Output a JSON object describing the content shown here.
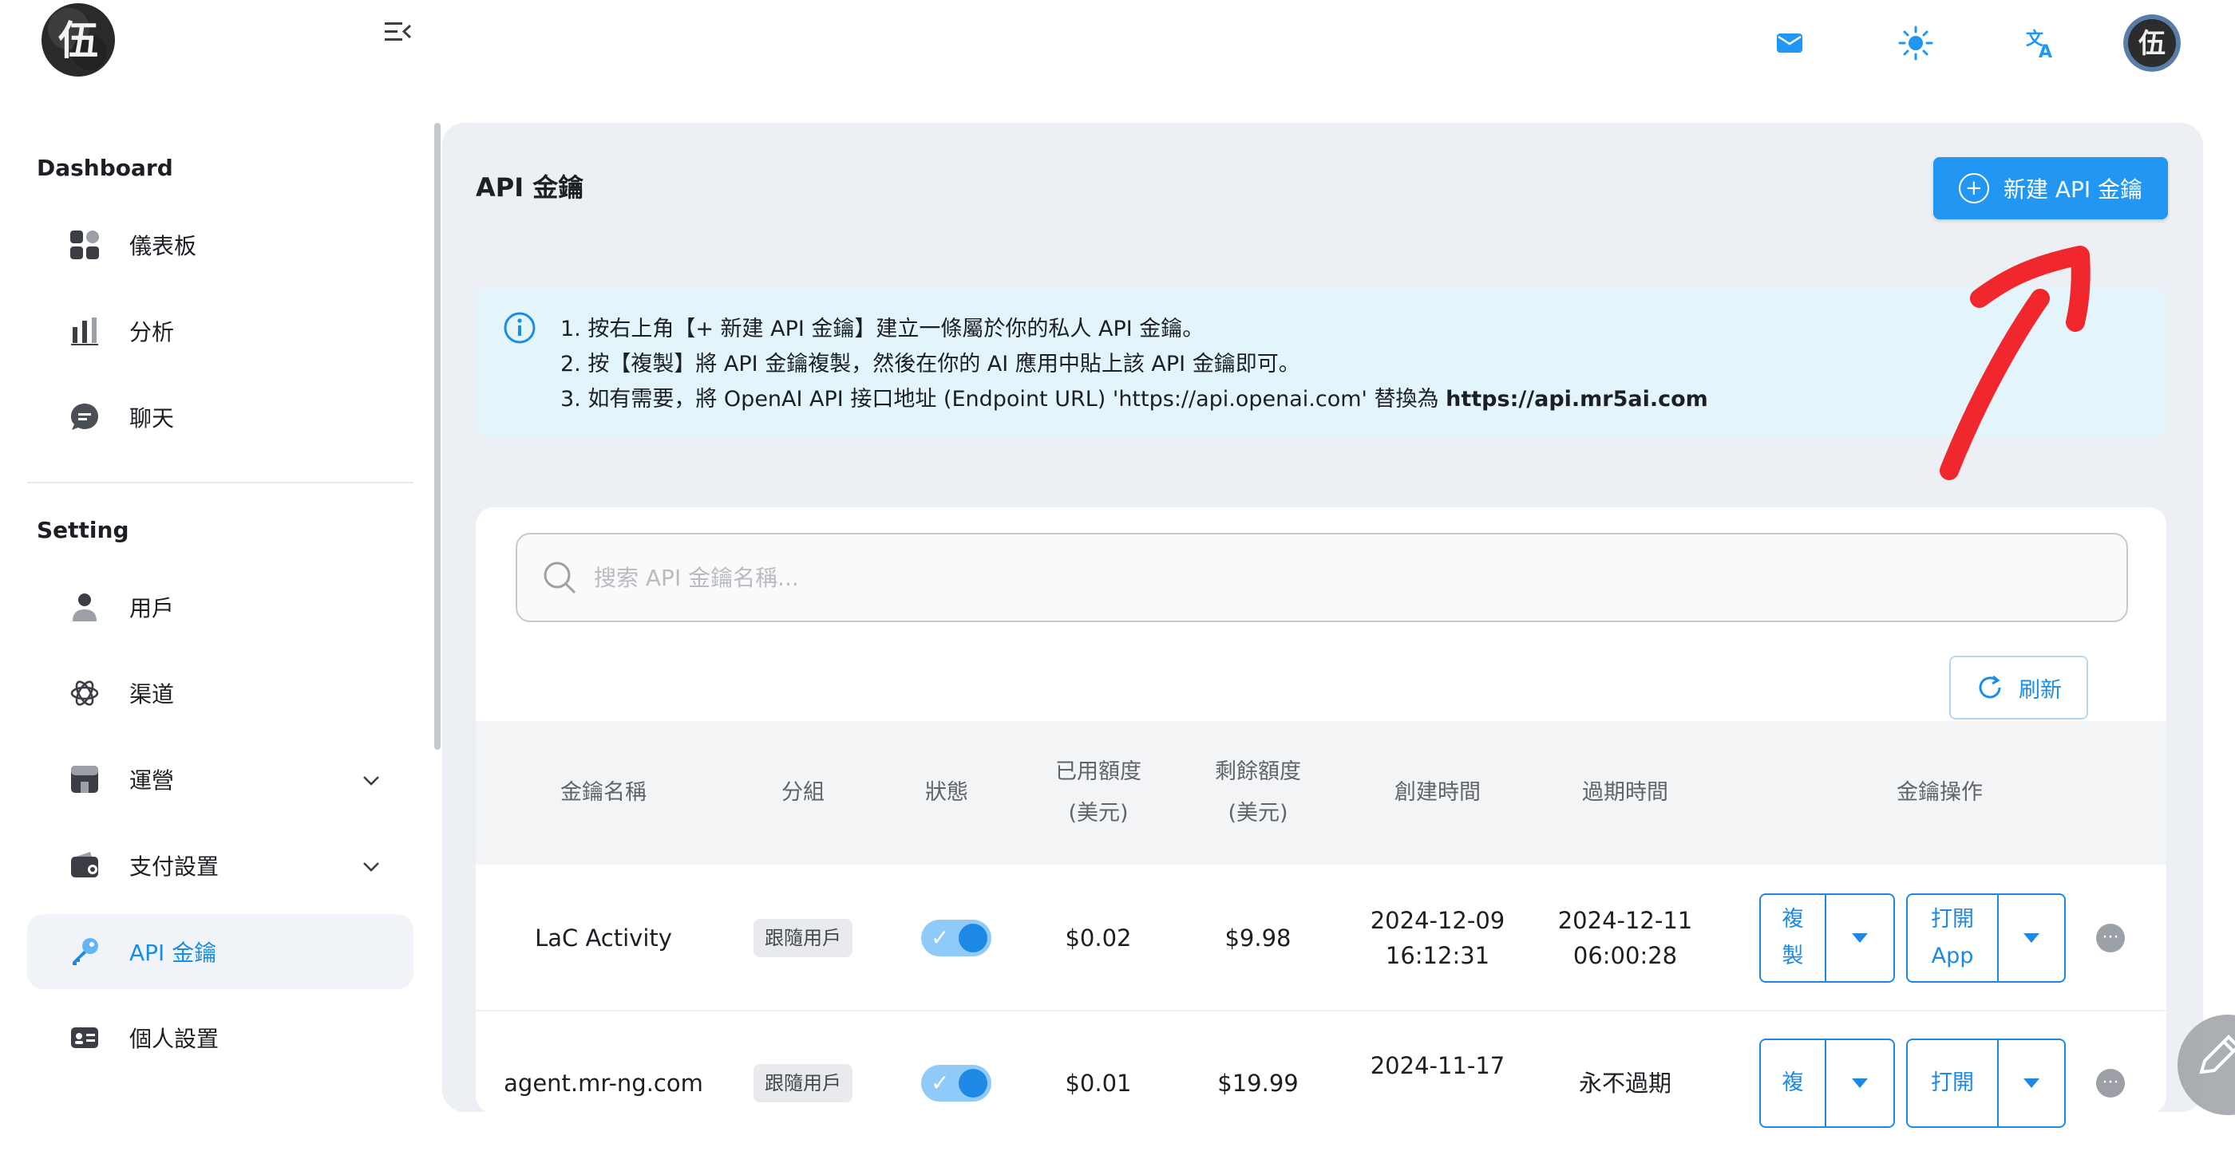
{
  "header": {
    "logo_char": "伍",
    "avatar_char": "伍",
    "icons": [
      "menu-collapse-icon",
      "mail-icon",
      "sun-icon",
      "translate-icon"
    ]
  },
  "sidebar": {
    "sections": [
      {
        "title": "Dashboard"
      },
      {
        "title": "Setting"
      }
    ],
    "items": [
      {
        "label": "儀表板",
        "icon": "dashboard-icon"
      },
      {
        "label": "分析",
        "icon": "bar-chart-icon"
      },
      {
        "label": "聊天",
        "icon": "chat-icon"
      },
      {
        "label": "用戶",
        "icon": "user-icon"
      },
      {
        "label": "渠道",
        "icon": "openai-icon"
      },
      {
        "label": "運營",
        "icon": "store-icon"
      },
      {
        "label": "支付設置",
        "icon": "wallet-icon"
      },
      {
        "label": "API 金鑰",
        "icon": "key-icon",
        "active": true
      },
      {
        "label": "個人設置",
        "icon": "id-card-icon"
      }
    ]
  },
  "page": {
    "title": "API 金鑰",
    "new_button": "新建 API 金鑰",
    "info": {
      "line1": "1. 按右上角【+ 新建 API 金鑰】建立一條屬於你的私人 API 金鑰。",
      "line2": "2. 按【複製】將 API 金鑰複製，然後在你的 AI 應用中貼上該 API 金鑰即可。",
      "line3_prefix": "3. 如有需要，將 OpenAI API 接口地址 (Endpoint URL) 'https://api.openai.com' 替換為 ",
      "line3_bold": "https://api.mr5ai.com"
    },
    "search_placeholder": "搜索 API 金鑰名稱...",
    "refresh_button": "刷新"
  },
  "table": {
    "columns": [
      "金鑰名稱",
      "分組",
      "狀態",
      "已用額度",
      "(美元)",
      "剩餘額度",
      "(美元)",
      "創建時間",
      "過期時間",
      "金鑰操作"
    ],
    "rows": [
      {
        "name": "LaC Activity",
        "group": "跟隨用戶",
        "enabled": true,
        "used": "$0.02",
        "remaining": "$9.98",
        "created_date": "2024-12-09",
        "created_time": "16:12:31",
        "expire_date": "2024-12-11",
        "expire_time": "06:00:28",
        "copy_a": "複",
        "copy_b": "製",
        "open_a": "打開",
        "open_b": "App"
      },
      {
        "name": "agent.mr-ng.com",
        "group": "跟隨用戶",
        "enabled": true,
        "used": "$0.01",
        "remaining": "$19.99",
        "created_date": "2024-11-17",
        "expire": "永不過期",
        "copy_a": "複",
        "open_a": "打開"
      }
    ]
  },
  "colors": {
    "accent": "#2196f3",
    "active_text": "#1b8ce6",
    "info_bg": "#e3f5fb",
    "panel_bg": "#eceff3",
    "annotation_arrow": "#f0282d"
  }
}
